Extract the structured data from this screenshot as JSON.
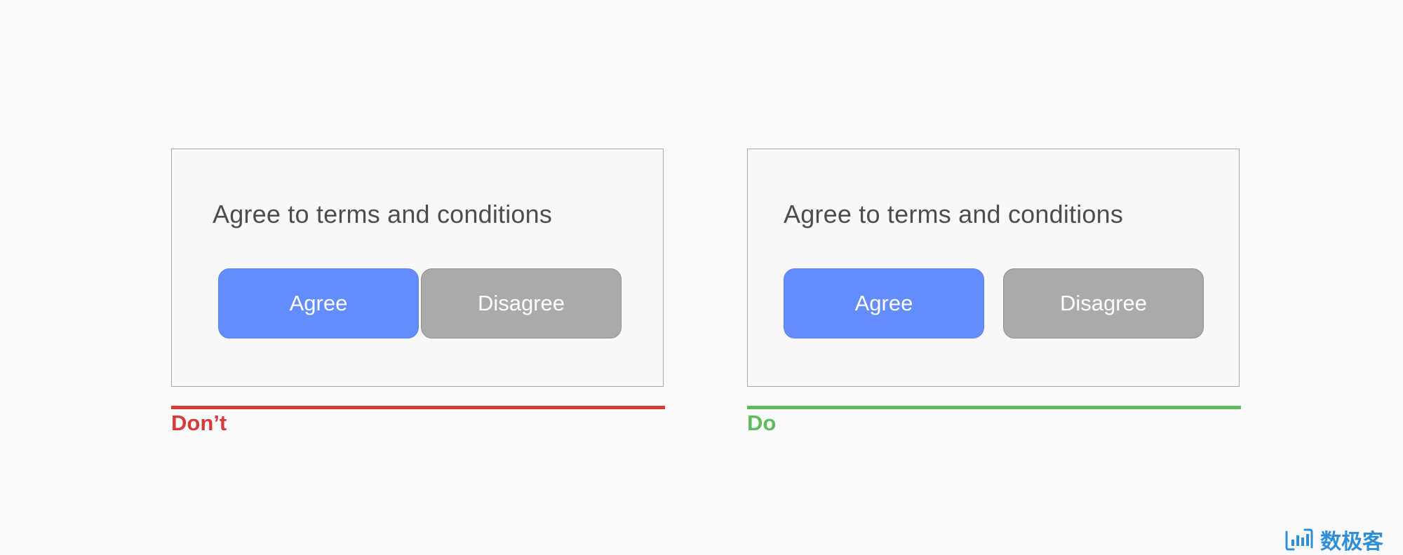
{
  "examples": [
    {
      "id": "dont",
      "prompt": "Agree to terms and conditions",
      "primary_label": "Agree",
      "secondary_label": "Disagree",
      "verdict": "Don’t",
      "verdict_color": "#d63b37"
    },
    {
      "id": "do",
      "prompt": "Agree to terms and conditions",
      "primary_label": "Agree",
      "secondary_label": "Disagree",
      "verdict": "Do",
      "verdict_color": "#5fbb5d"
    }
  ],
  "colors": {
    "primary_button": "#638cfc",
    "secondary_button": "#aaaaaa",
    "card_border": "#a8a8a8",
    "watermark": "#2f8fd6"
  },
  "watermark": {
    "icon": "bar-chart-logo-icon",
    "text": "数极客"
  }
}
